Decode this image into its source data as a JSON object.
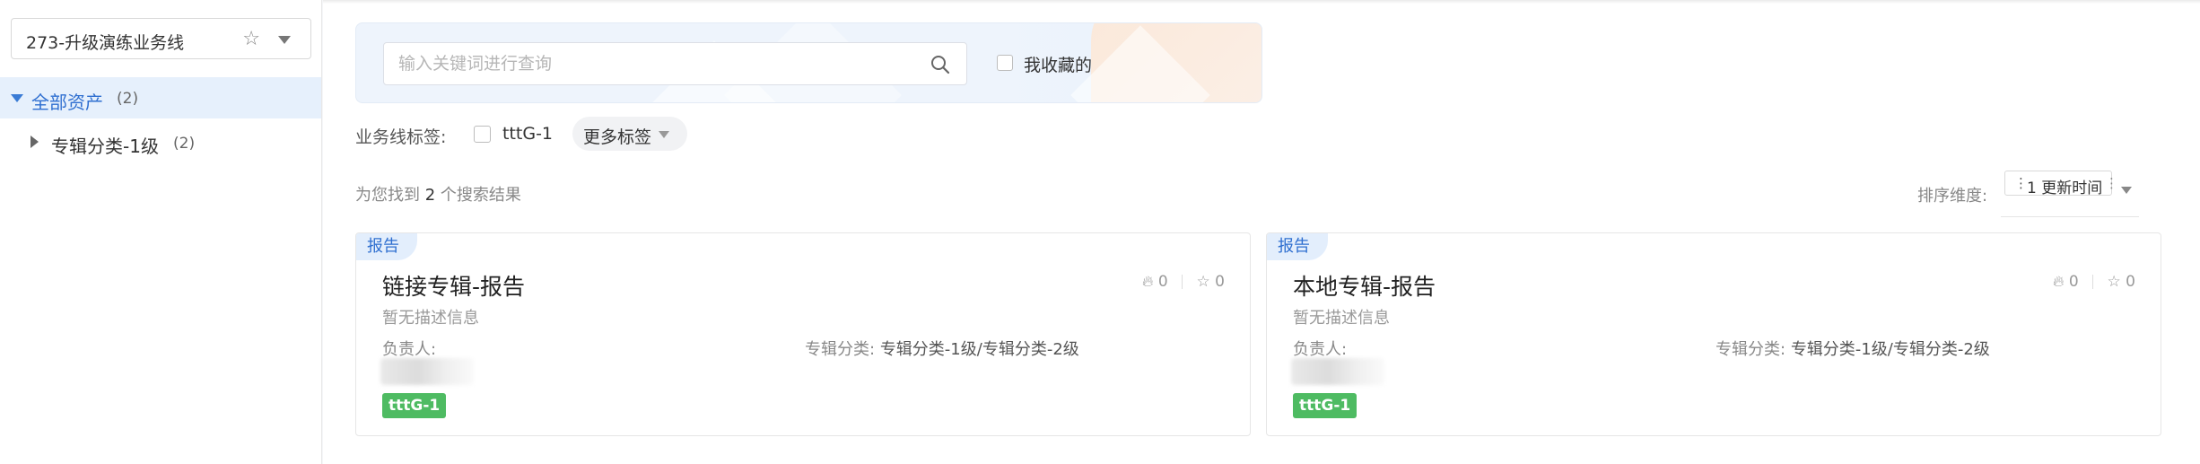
{
  "sidebar": {
    "business_line": "273-升级演练业务线",
    "tree": {
      "root": {
        "label": "全部资产",
        "count": "(2)"
      },
      "children": [
        {
          "label": "专辑分类-1级",
          "count": "(2)"
        }
      ]
    }
  },
  "search": {
    "placeholder": "输入关键词进行查询",
    "favorites_label": "我收藏的"
  },
  "tags": {
    "label": "业务线标签:",
    "items": [
      {
        "name": "tttG-1"
      }
    ],
    "more_label": "更多标签"
  },
  "results": {
    "prefix": "为您找到",
    "count": "2",
    "suffix": "个搜索结果"
  },
  "sort": {
    "label": "排序维度:",
    "value": "1 更新时间"
  },
  "cards": [
    {
      "type": "报告",
      "title": "链接专辑-报告",
      "likes": "0",
      "stars": "0",
      "description": "暂无描述信息",
      "owner_label": "负责人:",
      "category_label": "专辑分类:",
      "category_value": "专辑分类-1级/专辑分类-2级",
      "tag": "tttG-1"
    },
    {
      "type": "报告",
      "title": "本地专辑-报告",
      "likes": "0",
      "stars": "0",
      "description": "暂无描述信息",
      "owner_label": "负责人:",
      "category_label": "专辑分类:",
      "category_value": "专辑分类-1级/专辑分类-2级",
      "tag": "tttG-1"
    }
  ],
  "colors": {
    "accent": "#2f6fd0",
    "tag_green": "#4ebb62",
    "tree_selected_bg": "#e6f0fc"
  }
}
